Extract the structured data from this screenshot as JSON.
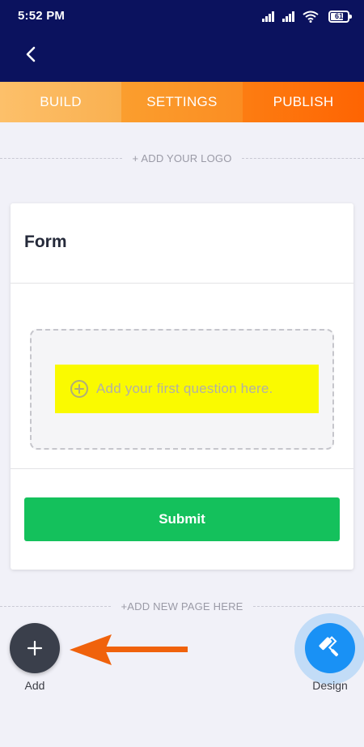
{
  "status_bar": {
    "time": "5:52 PM",
    "battery": "61",
    "icons": [
      "signal-icon",
      "signal-icon",
      "wifi-icon",
      "battery-icon"
    ]
  },
  "header": {
    "back_icon": "back-arrow-icon"
  },
  "tabs": [
    {
      "label": "BUILD",
      "active": true
    },
    {
      "label": "SETTINGS",
      "active": false
    },
    {
      "label": "PUBLISH",
      "active": false
    }
  ],
  "logo_divider": {
    "label": "+ ADD YOUR LOGO"
  },
  "form": {
    "title": "Form",
    "question_placeholder": "Add your first question here.",
    "submit_label": "Submit"
  },
  "page_divider": {
    "label": "+ADD NEW PAGE HERE"
  },
  "fabs": {
    "add_label": "Add",
    "design_label": "Design"
  },
  "colors": {
    "appbar": "#0b125e",
    "submit": "#14c15c",
    "highlight": "#fafa00",
    "design_fab": "#1991f5",
    "add_fab": "#3a3f4b",
    "annotation_arrow": "#f0620c"
  }
}
